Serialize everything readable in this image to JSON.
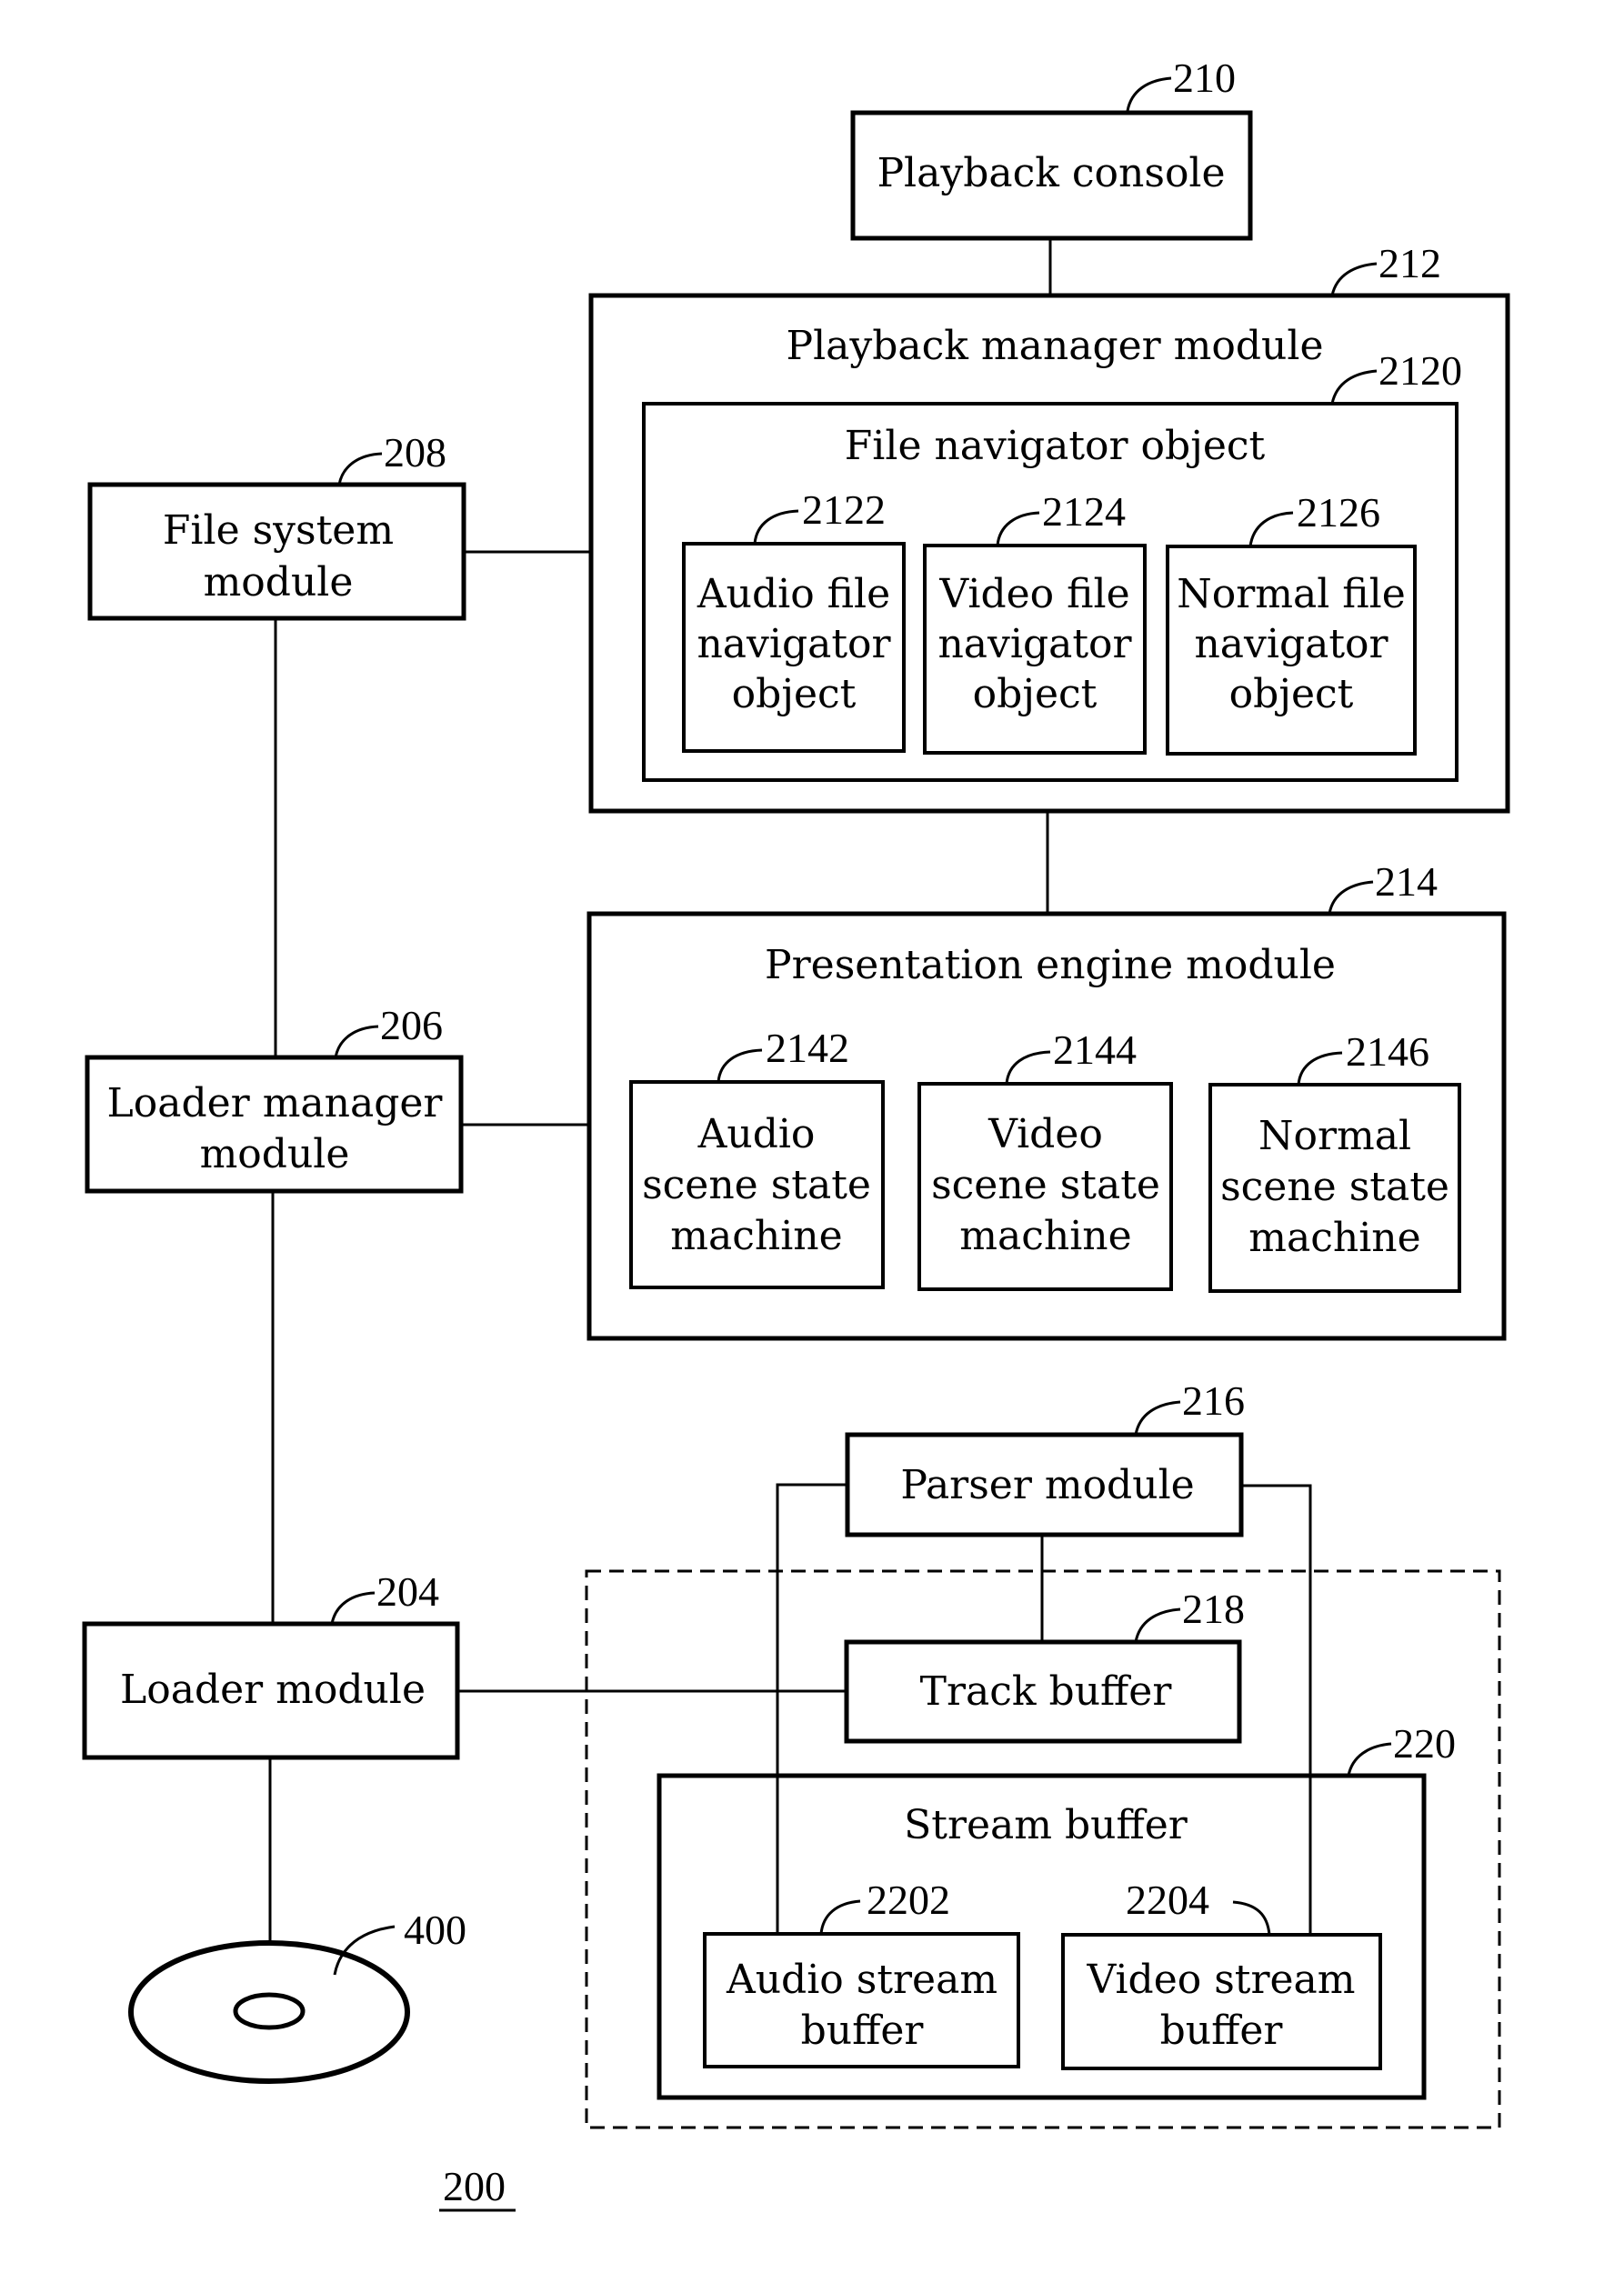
{
  "figure": {
    "number": "200",
    "nodes": {
      "playback_console": {
        "ref": "210",
        "lines": [
          "Playback console"
        ]
      },
      "playback_manager": {
        "ref": "212",
        "lines": [
          "Playback manager module"
        ]
      },
      "file_navigator": {
        "ref": "2120",
        "lines": [
          "File navigator object"
        ]
      },
      "audio_file_nav": {
        "ref": "2122",
        "lines": [
          "Audio file",
          "navigator",
          "object"
        ]
      },
      "video_file_nav": {
        "ref": "2124",
        "lines": [
          "Video file",
          "navigator",
          "object"
        ]
      },
      "normal_file_nav": {
        "ref": "2126",
        "lines": [
          "Normal file",
          "navigator",
          "object"
        ]
      },
      "file_system": {
        "ref": "208",
        "lines": [
          "File system",
          "module"
        ]
      },
      "presentation_engine": {
        "ref": "214",
        "lines": [
          "Presentation engine module"
        ]
      },
      "audio_scene": {
        "ref": "2142",
        "lines": [
          "Audio",
          "scene state",
          "machine"
        ]
      },
      "video_scene": {
        "ref": "2144",
        "lines": [
          "Video",
          "scene state",
          "machine"
        ]
      },
      "normal_scene": {
        "ref": "2146",
        "lines": [
          "Normal",
          "scene state",
          "machine"
        ]
      },
      "loader_manager": {
        "ref": "206",
        "lines": [
          "Loader manager",
          "module"
        ]
      },
      "parser": {
        "ref": "216",
        "lines": [
          "Parser module"
        ]
      },
      "loader": {
        "ref": "204",
        "lines": [
          "Loader module"
        ]
      },
      "track_buffer": {
        "ref": "218",
        "lines": [
          "Track buffer"
        ]
      },
      "stream_buffer": {
        "ref": "220",
        "lines": [
          "Stream buffer"
        ]
      },
      "audio_stream": {
        "ref": "2202",
        "lines": [
          "Audio stream",
          "buffer"
        ]
      },
      "video_stream": {
        "ref": "2204",
        "lines": [
          "Video stream",
          "buffer"
        ]
      },
      "disc": {
        "ref": "400"
      }
    },
    "connections": [
      [
        "playback_console",
        "playback_manager"
      ],
      [
        "file_system",
        "playback_manager"
      ],
      [
        "playback_manager",
        "presentation_engine"
      ],
      [
        "loader_manager",
        "presentation_engine"
      ],
      [
        "file_system",
        "loader_manager"
      ],
      [
        "loader_manager",
        "loader"
      ],
      [
        "loader",
        "track_buffer"
      ],
      [
        "loader",
        "disc"
      ],
      [
        "parser",
        "track_buffer"
      ],
      [
        "parser",
        "audio_stream"
      ],
      [
        "parser",
        "video_stream"
      ]
    ]
  }
}
